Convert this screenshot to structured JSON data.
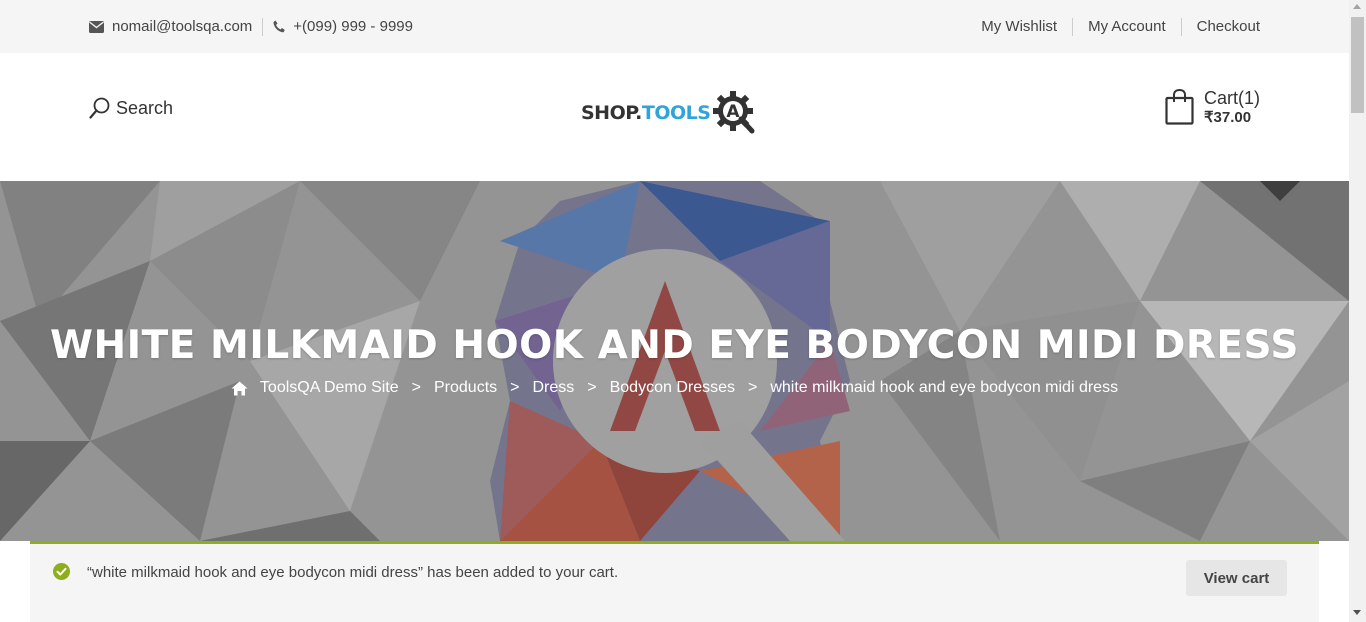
{
  "topbar": {
    "email": "nomail@toolsqa.com",
    "phone": "+(099) 999 - 9999",
    "links": [
      "My Wishlist",
      "My Account",
      "Checkout"
    ]
  },
  "header": {
    "search_label": "Search",
    "logo_part1": "SHOP.",
    "logo_part2": "TOOLS",
    "logo_badge": "A",
    "cart_label": "Cart(1)",
    "cart_amount": "₹37.00"
  },
  "hero": {
    "title": "WHITE MILKMAID HOOK AND EYE BODYCON MIDI DRESS",
    "breadcrumbs": [
      "ToolsQA Demo Site",
      "Products",
      "Dress",
      "Bodycon Dresses",
      "white milkmaid hook and eye bodycon midi dress"
    ],
    "separator": ">"
  },
  "notice": {
    "message": "“white milkmaid hook and eye bodycon midi dress” has been added to your cart.",
    "button_label": "View cart"
  },
  "colors": {
    "accent": "#2fa4dc",
    "notice_border": "#8fae1b",
    "check": "#8fae1b"
  },
  "icons": [
    "envelope-icon",
    "phone-icon",
    "search-icon",
    "shopping-bag-icon",
    "home-icon",
    "check-circle-icon"
  ]
}
